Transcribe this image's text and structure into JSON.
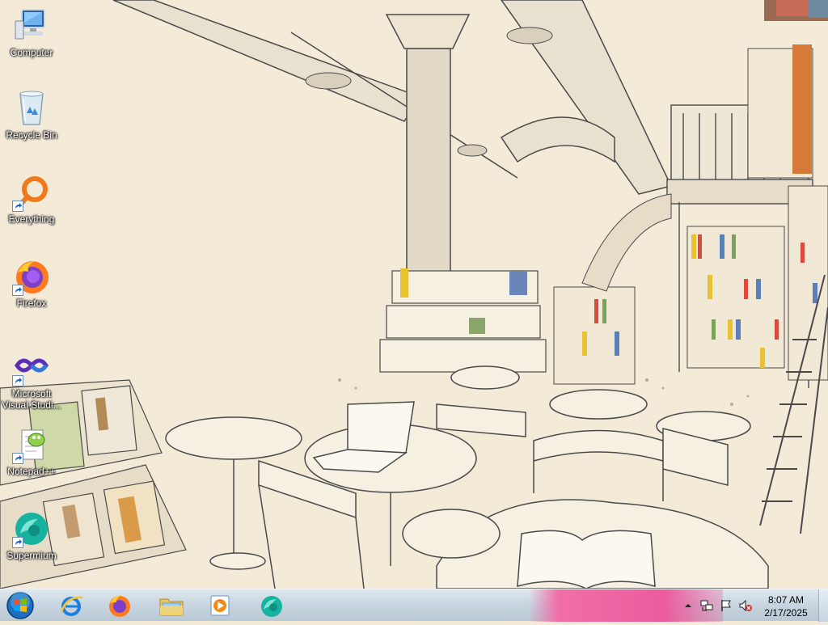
{
  "desktop": {
    "icons": [
      {
        "label": "Computer",
        "icon": "computer-icon",
        "shortcut": false
      },
      {
        "label": "Recycle Bin",
        "icon": "recycle-bin-icon",
        "shortcut": false
      },
      {
        "label": "Everything",
        "icon": "everything-search-icon",
        "shortcut": true
      },
      {
        "label": "Firefox",
        "icon": "firefox-icon",
        "shortcut": true
      },
      {
        "label": "Microsoft Visual Studi...",
        "icon": "visual-studio-icon",
        "shortcut": true
      },
      {
        "label": "Notepad++",
        "icon": "notepad-plus-plus-icon",
        "shortcut": true
      },
      {
        "label": "Supermium",
        "icon": "supermium-icon",
        "shortcut": true
      }
    ],
    "wallpaper": "hand-drawn bookstore cafe illustration"
  },
  "taskbar": {
    "start_icon": "windows-start-orb-icon",
    "pinned": [
      {
        "name": "Internet Explorer",
        "icon": "internet-explorer-icon"
      },
      {
        "name": "Firefox",
        "icon": "firefox-icon"
      },
      {
        "name": "Windows Explorer",
        "icon": "folder-icon"
      },
      {
        "name": "Windows Media Player",
        "icon": "media-player-icon"
      },
      {
        "name": "Supermium",
        "icon": "supermium-icon"
      }
    ],
    "tray": {
      "icons": [
        "show-hidden-icons-chevron",
        "network-icon",
        "action-center-flag-icon",
        "volume-muted-icon"
      ],
      "time": "8:07 AM",
      "date": "2/17/2025"
    }
  },
  "colors": {
    "paper": "#f3ead8",
    "taskbar": "#c9d6e1",
    "accent_pink": "#ec5c9c"
  }
}
